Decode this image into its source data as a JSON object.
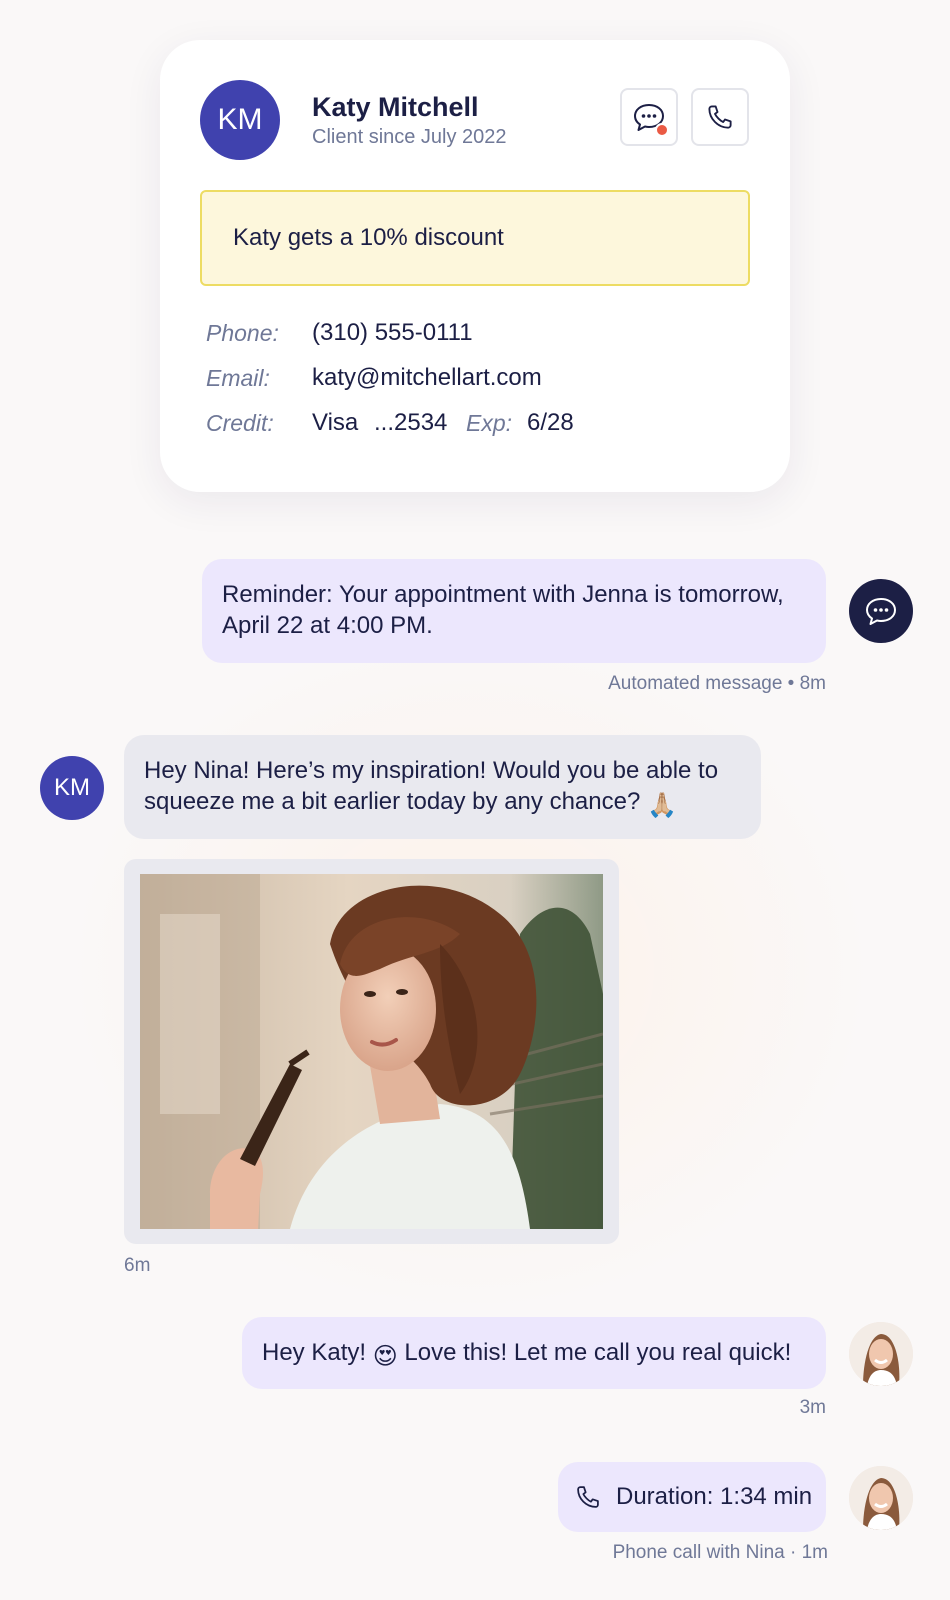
{
  "contact": {
    "initials": "KM",
    "name": "Katy Mitchell",
    "since": "Client since July 2022",
    "discount_note": "Katy gets a 10% discount",
    "phone_label": "Phone:",
    "phone": "(310) 555-0111",
    "email_label": "Email:",
    "email": "katy@mitchellart.com",
    "credit_label": "Credit:",
    "card_brand": "Visa",
    "card_last4": "...2534",
    "exp_label": "Exp:",
    "exp": "6/28",
    "message_button_icon": "chat-bubble-icon",
    "call_button_icon": "phone-icon",
    "unread_indicator_color": "#ea5a44"
  },
  "messages": {
    "reminder": {
      "text": "Reminder: Your appointment with Jenna is tomorrow, April 22 at 4:00 PM.",
      "meta": "Automated message • 8m",
      "avatar_icon": "chat-bubble-icon"
    },
    "client_msg": {
      "initials": "KM",
      "text": "Hey Nina! Here’s my inspiration! Would you be able to squeeze me a bit earlier today by any chance?",
      "emoji": "🙏🏼"
    },
    "client_image": {
      "meta": "6m"
    },
    "reply": {
      "text_before": "Hey Katy!",
      "emoji": "😍",
      "text_after": "Love this! Let me call you real quick!",
      "meta": "3m"
    },
    "call": {
      "icon": "phone-icon",
      "text": "Duration: 1:34 min",
      "meta": "Phone call with Nina · 1m"
    }
  },
  "colors": {
    "accent_indigo": "#4042ae",
    "navy": "#1c1f45",
    "outgoing_bubble": "#ece7fd",
    "incoming_bubble": "#e9e9ef",
    "discount_bg": "#fdf7dc",
    "discount_border": "#eddc63"
  }
}
